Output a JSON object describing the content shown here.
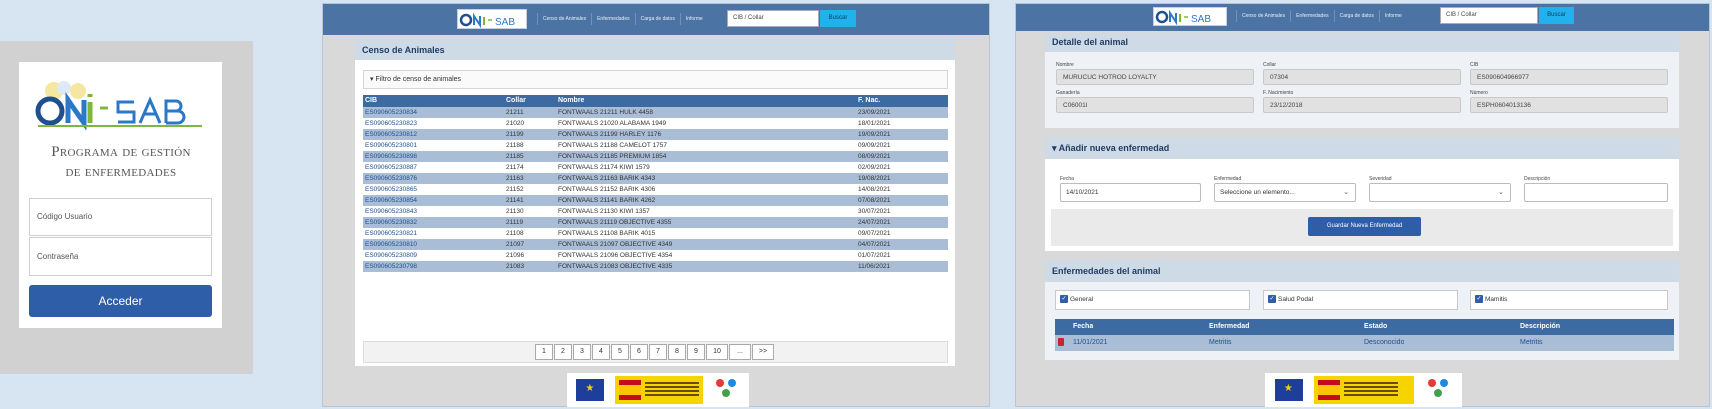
{
  "brand": {
    "logo_text": "ONISAB",
    "logo_colors": {
      "primary": "#1f4f8f",
      "accent": "#7db83a",
      "blue": "#2b78c9"
    }
  },
  "login": {
    "heading_line1": "Programa de gestión",
    "heading_line2": "de enfermedades",
    "user_placeholder": "Código Usuario",
    "password_placeholder": "Contraseña",
    "submit_label": "Acceder"
  },
  "nav": {
    "links": [
      "Censo de Animales",
      "Enfermedades",
      "Carga de datos",
      "Informe"
    ],
    "search_placeholder": "CIB / Collar",
    "search_button": "Buscar"
  },
  "census": {
    "title": "Censo de Animales",
    "filter_label": "▾ Filtro de censo de animales",
    "columns": [
      "CIB",
      "Collar",
      "Nombre",
      "F. Nac."
    ],
    "rows": [
      [
        "ES090605230834",
        "21211",
        "FONTWAALS 21211 HULK 4458",
        "23/09/2021"
      ],
      [
        "ES090605230823",
        "21020",
        "FONTWAALS 21020 ALABAMA 1949",
        "18/01/2021"
      ],
      [
        "ES090605230812",
        "21199",
        "FONTWAALS 21199 HARLEY 1176",
        "19/09/2021"
      ],
      [
        "ES090605230801",
        "21188",
        "FONTWAALS 21188 CAMELOT 1757",
        "09/09/2021"
      ],
      [
        "ES090605230898",
        "21185",
        "FONTWAALS 21185 PREMIUM 1854",
        "08/09/2021"
      ],
      [
        "ES090605230887",
        "21174",
        "FONTWAALS 21174 KIWI 1579",
        "02/09/2021"
      ],
      [
        "ES090605230876",
        "21163",
        "FONTWAALS 21163 BARIK 4343",
        "19/08/2021"
      ],
      [
        "ES090605230865",
        "21152",
        "FONTWAALS 21152 BARIK 4306",
        "14/08/2021"
      ],
      [
        "ES090605230854",
        "21141",
        "FONTWAALS 21141 BARIK 4262",
        "07/08/2021"
      ],
      [
        "ES090605230843",
        "21130",
        "FONTWAALS 21130 KIWI 1357",
        "30/07/2021"
      ],
      [
        "ES090605230832",
        "21119",
        "FONTWAALS 21119 OBJECTIVE 4355",
        "24/07/2021"
      ],
      [
        "ES090605230821",
        "21108",
        "FONTWAALS 21108 BARIK 4015",
        "09/07/2021"
      ],
      [
        "ES090605230810",
        "21097",
        "FONTWAALS 21097 OBJECTIVE 4349",
        "04/07/2021"
      ],
      [
        "ES090605230809",
        "21096",
        "FONTWAALS 21096 OBJECTIVE 4354",
        "01/07/2021"
      ],
      [
        "ES090605230798",
        "21083",
        "FONTWAALS 21083 OBJECTIVE 4335",
        "11/06/2021"
      ]
    ],
    "pages": [
      "1",
      "2",
      "3",
      "4",
      "5",
      "6",
      "7",
      "8",
      "9",
      "10",
      "...",
      ">>"
    ]
  },
  "detail": {
    "title": "Detalle del animal",
    "fields": [
      {
        "label": "Nombre",
        "value": "MURUCUC HOTROD LOYALTY"
      },
      {
        "label": "Collar",
        "value": "07304"
      },
      {
        "label": "CIB",
        "value": "ES090604966977"
      },
      {
        "label": "Ganadería",
        "value": "C06001I"
      },
      {
        "label": "F. Nacimiento",
        "value": "23/12/2018"
      },
      {
        "label": "Número",
        "value": "ESPH0604013136"
      }
    ],
    "add_disease": {
      "title": "▾ Añadir nueva enfermedad",
      "date_label": "Fecha",
      "date_value": "14/10/2021",
      "disease_label": "Enfermedad",
      "disease_value": "Seleccione un elemento...",
      "severity_label": "Severidad",
      "severity_value": "",
      "description_label": "Descripción",
      "description_value": "",
      "save_label": "Guardar Nueva Enfermedad"
    },
    "diseases": {
      "title": "Enfermedades del animal",
      "checks": [
        "General",
        "Salud Podal",
        "Mamitis"
      ],
      "columns": [
        "Fecha",
        "Enfermedad",
        "Estado",
        "Descripción"
      ],
      "rows": [
        [
          "11/01/2021",
          "Metritis",
          "Desconocido",
          "Metritis"
        ]
      ]
    }
  },
  "colors": {
    "nav": "#4b74a4",
    "table_header": "#3d6aa0",
    "row_alt": "#a9bed6",
    "button": "#2f5ea8",
    "search_button": "#21b1ec"
  }
}
